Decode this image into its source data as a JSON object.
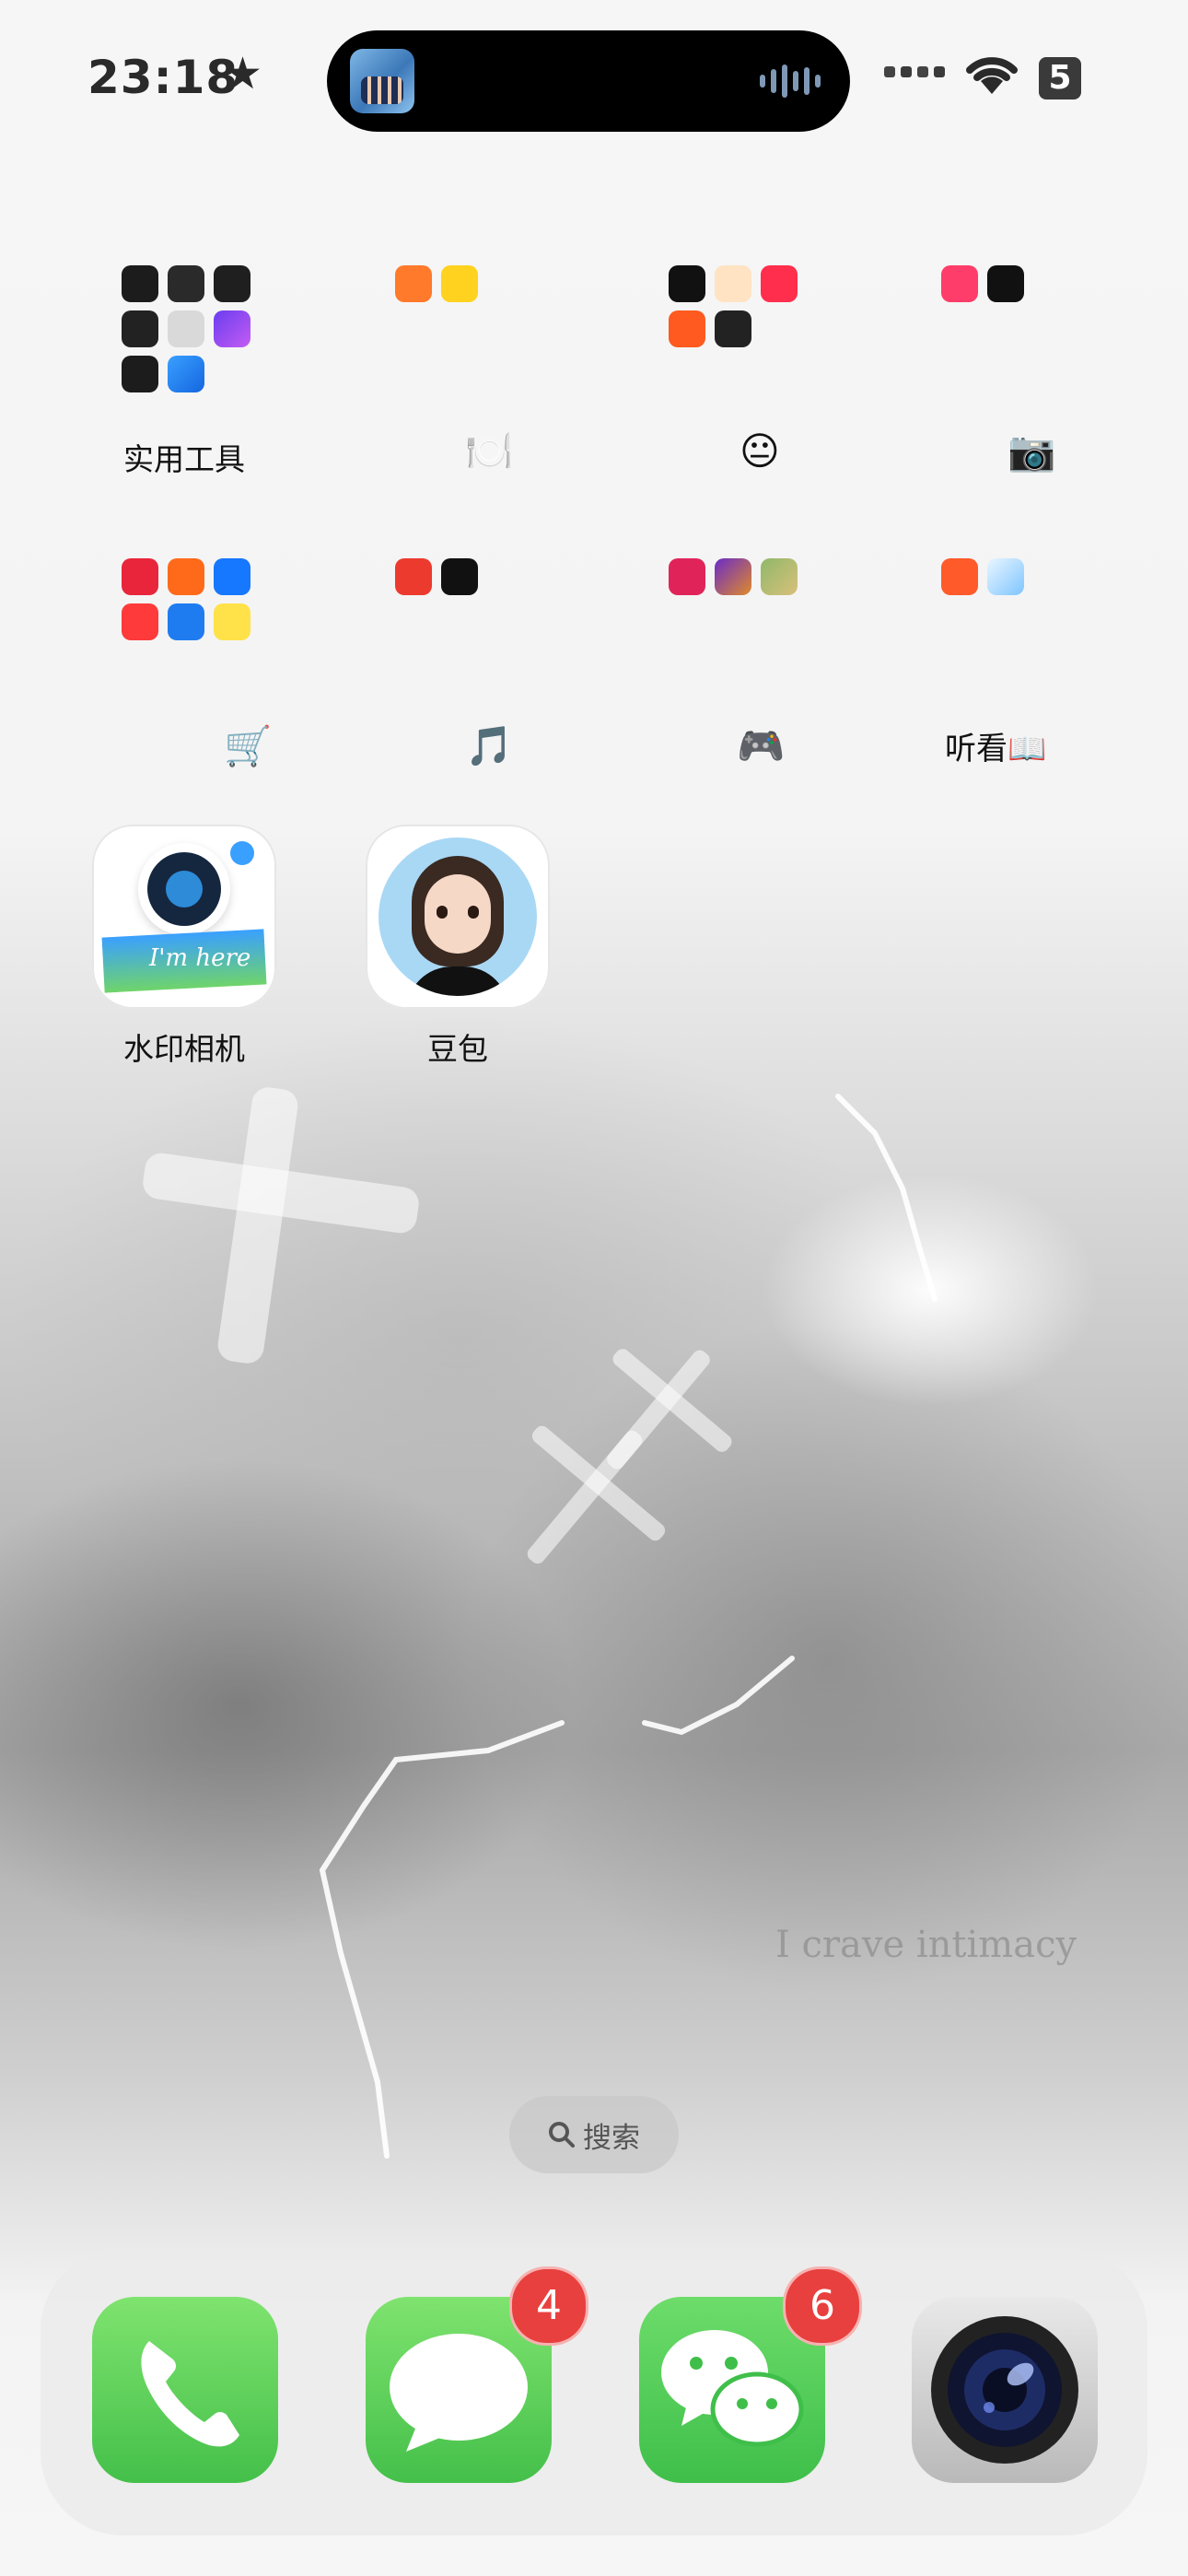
{
  "status_bar": {
    "time": "23:18",
    "battery": "5"
  },
  "folders": [
    {
      "name": "实用工具",
      "apps": [
        "voice-memo",
        "stopwatch",
        "calendar-grid",
        "magnifier",
        "calculator",
        "shortcuts",
        "wallet-keys",
        "app-store-widgets"
      ]
    },
    {
      "name": "🍽️",
      "apps": [
        "taobao-shangou",
        "meituan"
      ]
    },
    {
      "name": "😐",
      "apps": [
        "tiktok",
        "weibo",
        "xiaohongshu",
        "kuaishou",
        "bilibili-dark"
      ]
    },
    {
      "name": "📷",
      "apps": [
        "meitu",
        "beauty-cam"
      ]
    },
    {
      "name": "🛒",
      "apps": [
        "pinduoduo",
        "taobao",
        "alipay",
        "jd",
        "qq-shop",
        "xianyu"
      ]
    },
    {
      "name": "🎵",
      "apps": [
        "netease-music",
        "qq-music"
      ]
    },
    {
      "name": "🎮",
      "apps": [
        "game-1",
        "game-2",
        "game-3"
      ]
    },
    {
      "name": "听看📖",
      "apps": [
        "qidian",
        "browser"
      ]
    }
  ],
  "apps": [
    {
      "name": "水印相机",
      "icon": "watermark-camera-icon",
      "sticker_text": "I'm here"
    },
    {
      "name": "豆包",
      "icon": "doubao-icon"
    }
  ],
  "wallpaper_text": "I crave intimacy",
  "search": {
    "label": "搜索"
  },
  "dock": [
    {
      "icon": "phone-icon"
    },
    {
      "icon": "messages-icon",
      "badge": "4"
    },
    {
      "icon": "wechat-icon",
      "badge": "6"
    },
    {
      "icon": "camera-icon"
    }
  ],
  "colors": {
    "badge": "#e8403e",
    "dock_green": "#5cd163"
  }
}
